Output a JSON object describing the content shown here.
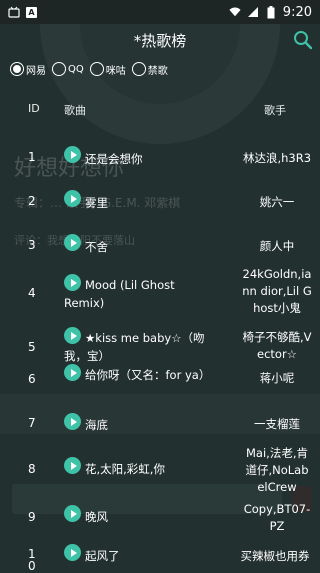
{
  "status_bar": {
    "time": "9:20"
  },
  "header": {
    "title": "*热歌榜"
  },
  "sources": [
    {
      "label": "网易",
      "selected": true
    },
    {
      "label": "QQ",
      "selected": false
    },
    {
      "label": "咪咕",
      "selected": false
    },
    {
      "label": "禁歌",
      "selected": false
    }
  ],
  "table": {
    "columns": {
      "id": "ID",
      "song": "歌曲",
      "artist": "歌手"
    },
    "rows": [
      {
        "id": "1",
        "song": "还是会想你",
        "artist": "林达浪,h3R3"
      },
      {
        "id": "2",
        "song": "雾里",
        "artist": "姚六一"
      },
      {
        "id": "3",
        "song": "不舍",
        "artist": "颜人中"
      },
      {
        "id": "4",
        "song": "Mood (Lil Ghost Remix)",
        "artist": "24kGoldn,iann dior,Lil Ghost小鬼"
      },
      {
        "id": "5",
        "song": "★kiss me baby☆（吻我，宝）",
        "artist": "椅子不够酷,Vector☆"
      },
      {
        "id": "6",
        "song": "给你呀（又名：for ya）",
        "artist": "蒋小呢"
      },
      {
        "id": "7",
        "song": "海底",
        "artist": "一支榴莲"
      },
      {
        "id": "8",
        "song": "花,太阳,彩虹,你",
        "artist": "Mai,法老,肯道仔,NoLabelCrew"
      },
      {
        "id": "9",
        "song": "晚风",
        "artist": "Copy,BT07-PZ"
      },
      {
        "id": "10",
        "song": "起风了",
        "artist": "买辣椒也用券"
      }
    ]
  },
  "background_ghost": {
    "lyric": "好想好想你",
    "lyric_sub": "专辑：…    歌手：G.E.M. 邓紫棋",
    "comment": "评论：我想太阳不要落山"
  },
  "colors": {
    "background": "#22302f",
    "accent": "#3ec2a8",
    "statusbar": "#1d2625"
  }
}
